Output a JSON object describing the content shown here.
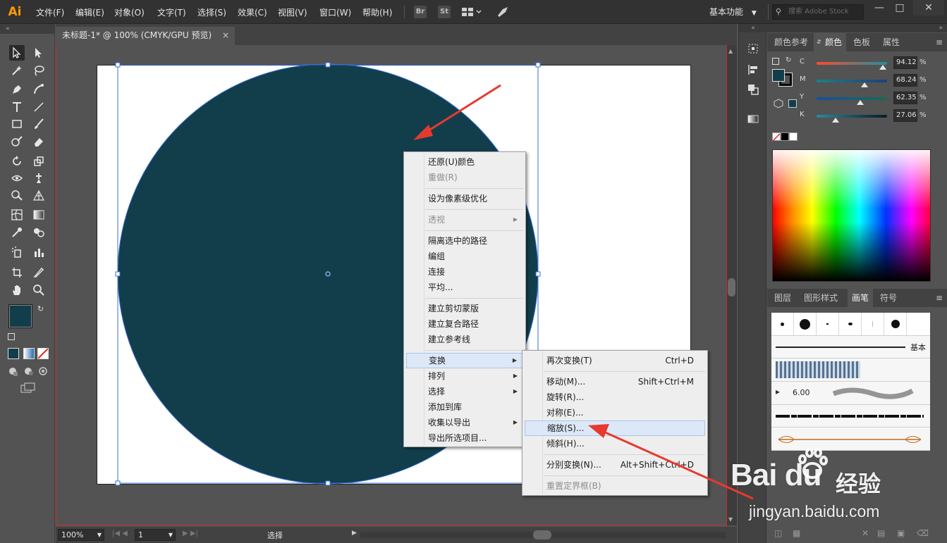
{
  "app": {
    "logo": "Ai",
    "menu": [
      "文件(F)",
      "编辑(E)",
      "对象(O)",
      "文字(T)",
      "选择(S)",
      "效果(C)",
      "视图(V)",
      "窗口(W)",
      "帮助(H)"
    ],
    "bridge_label": "Br",
    "stock_label": "St",
    "workspace": "基本功能",
    "search_placeholder": "搜索 Adobe Stock",
    "minimize": "—",
    "maximize": "□",
    "close": "✕"
  },
  "document": {
    "tab_title": "未标题-1* @ 100% (CMYK/GPU 预览)",
    "tab_close": "×",
    "fill_color": "#123e4b",
    "selection_color": "#3a6fd8"
  },
  "status_bar": {
    "zoom": "100%",
    "artboard_number": "1",
    "status_text": "选择"
  },
  "context_menu": {
    "items": {
      "undo": "还原(U)颜色",
      "redo": "重做(R)",
      "pixel_optimize": "设为像素级优化",
      "perspective": "透视",
      "isolate": "隔离选中的路径",
      "group": "编组",
      "join": "连接",
      "average": "平均...",
      "clip_mask": "建立剪切蒙版",
      "compound_path": "建立复合路径",
      "guides": "建立参考线",
      "transform": "变换",
      "arrange": "排列",
      "select": "选择",
      "add_to_library": "添加到库",
      "collect_export": "收集以导出",
      "export_selected": "导出所选项目..."
    }
  },
  "transform_submenu": {
    "transform_again": {
      "label": "再次变换(T)",
      "shortcut": "Ctrl+D"
    },
    "move": {
      "label": "移动(M)...",
      "shortcut": "Shift+Ctrl+M"
    },
    "rotate": {
      "label": "旋转(R)..."
    },
    "reflect": {
      "label": "对称(E)..."
    },
    "scale": {
      "label": "缩放(S)..."
    },
    "shear": {
      "label": "倾斜(H)..."
    },
    "transform_each": {
      "label": "分别变换(N)...",
      "shortcut": "Alt+Shift+Ctrl+D"
    },
    "reset_bbox": {
      "label": "重置定界框(B)"
    }
  },
  "color_panel": {
    "tabs": [
      "颜色参考",
      "颜色",
      "色板",
      "属性"
    ],
    "active_tab": "颜色",
    "channels": [
      {
        "label": "C",
        "value": "94.12",
        "percent": 94.12,
        "gradient": "linear-gradient(90deg,#ff4a2e,#1e8fa0)"
      },
      {
        "label": "M",
        "value": "68.24",
        "percent": 68.24,
        "gradient": "linear-gradient(90deg,#1f7f84,#1d3f7e)"
      },
      {
        "label": "Y",
        "value": "62.35",
        "percent": 62.35,
        "gradient": "linear-gradient(90deg,#1a4f9a,#1a6a55)"
      },
      {
        "label": "K",
        "value": "27.06",
        "percent": 27.06,
        "gradient": "linear-gradient(90deg,#2a8aa0,#0b1a20)"
      }
    ],
    "pct": "%"
  },
  "brush_panel": {
    "tabs": [
      "图层",
      "图形样式",
      "画笔",
      "符号"
    ],
    "active_tab": "画笔",
    "basic_label": "基本",
    "brush_size": "6.00"
  },
  "watermark": {
    "logo": "Bai du",
    "brand": "经验",
    "url": "jingyan.baidu.com"
  }
}
